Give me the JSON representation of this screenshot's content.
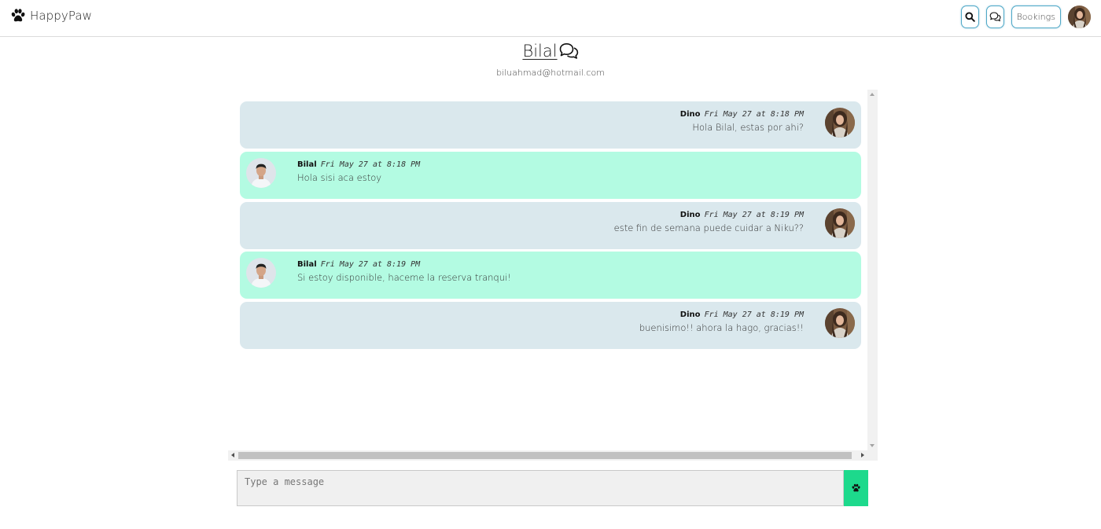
{
  "navbar": {
    "brand_name": "HappyPaw",
    "brand_icon": "paw-icon",
    "search_icon": "search-icon",
    "messages_icon": "chat-bubbles-icon",
    "bookings_label": "Bookings",
    "accent_color": "#4fa8c7"
  },
  "conversation": {
    "contact_name": "Bilal",
    "contact_email": "biluahmad@hotmail.com",
    "title_icon": "chat-bubbles-icon"
  },
  "messages": [
    {
      "author": "Dino",
      "time": "Fri May 27 at 8:18 PM",
      "text": "Hola Bilal, estas por ahi?",
      "side": "mine"
    },
    {
      "author": "Bilal",
      "time": "Fri May 27 at 8:18 PM",
      "text": "Hola sisi aca estoy",
      "side": "theirs"
    },
    {
      "author": "Dino",
      "time": "Fri May 27 at 8:19 PM",
      "text": "este fin de semana puede cuidar a Niku??",
      "side": "mine"
    },
    {
      "author": "Bilal",
      "time": "Fri May 27 at 8:19 PM",
      "text": "Si estoy disponible, haceme la reserva tranqui!",
      "side": "theirs"
    },
    {
      "author": "Dino",
      "time": "Fri May 27 at 8:19 PM",
      "text": "buenisimo!! ahora la hago, gracias!!",
      "side": "mine"
    }
  ],
  "colors": {
    "mine_bubble": "#dae8ed",
    "theirs_bubble": "#b3fbe2",
    "send_button": "#1dd98c"
  },
  "composer": {
    "placeholder": "Type a message",
    "value": "",
    "send_icon": "paw-icon"
  }
}
